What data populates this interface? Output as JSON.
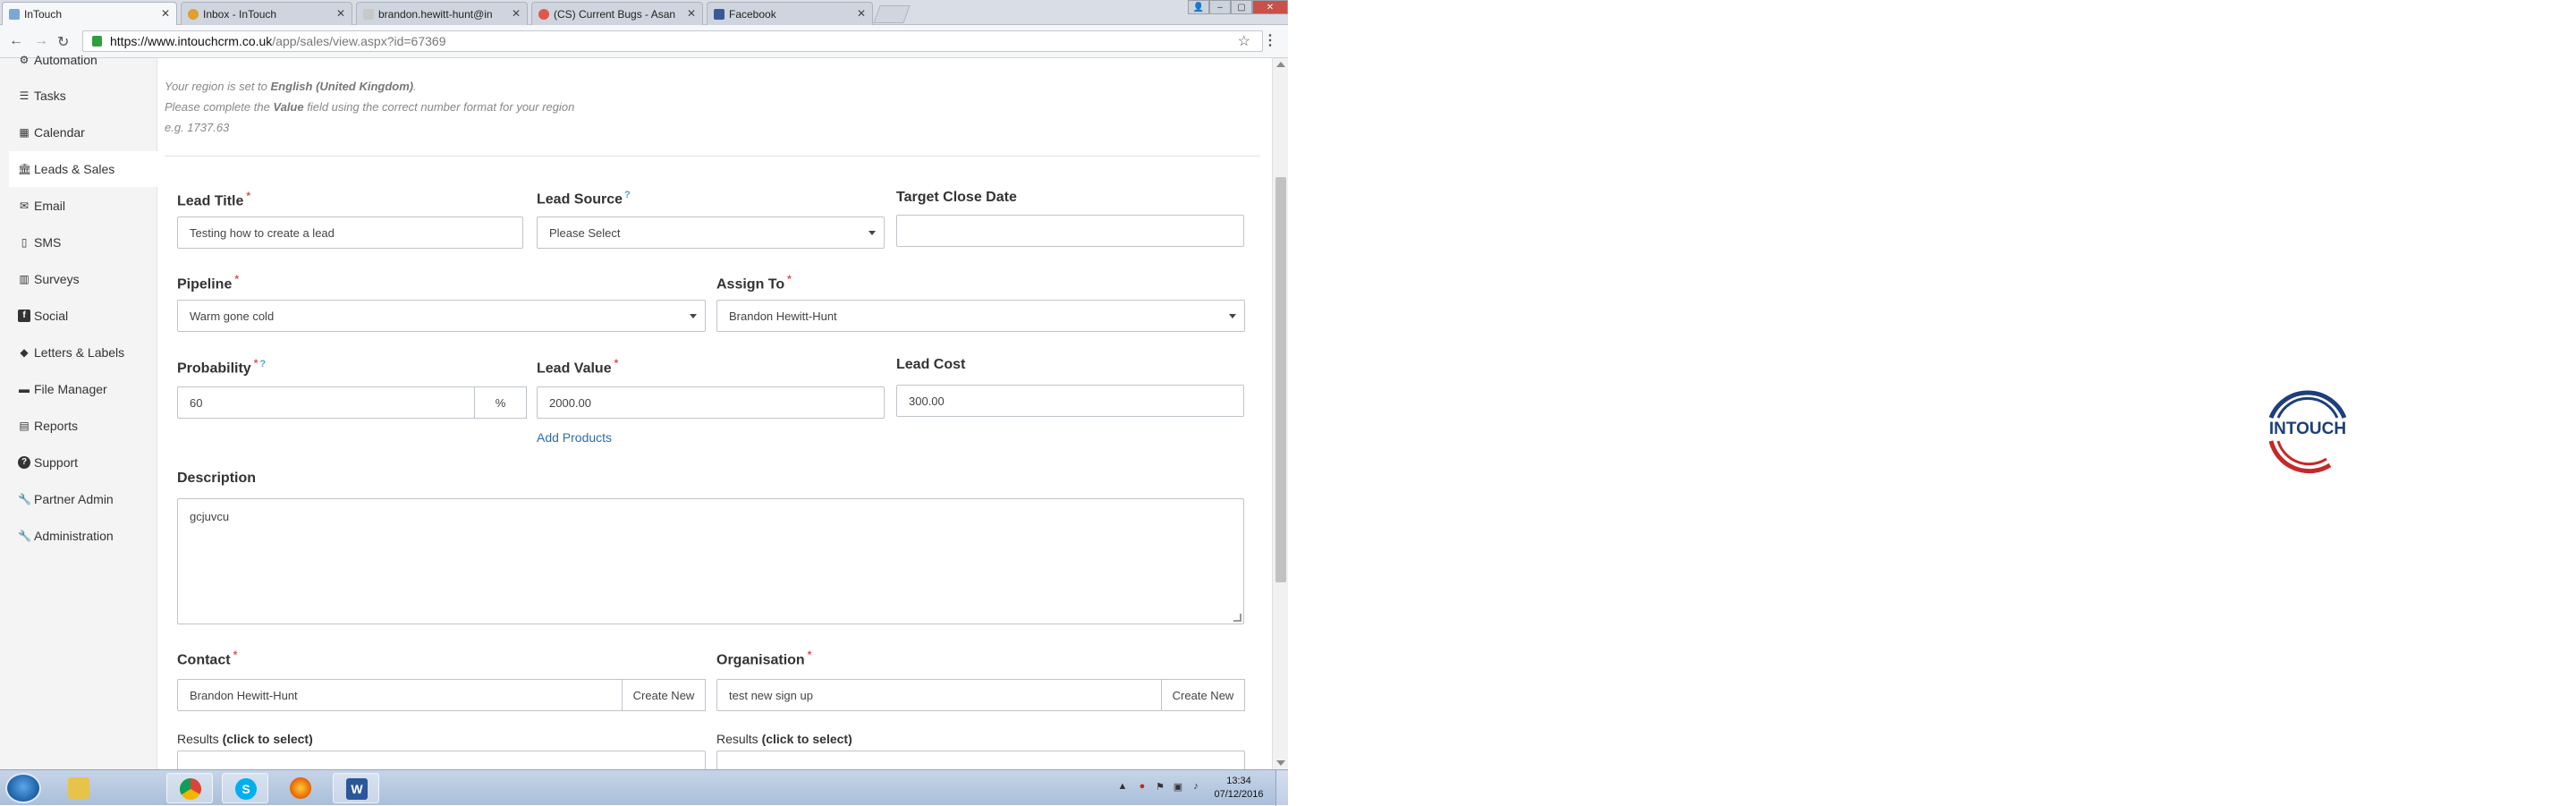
{
  "browser": {
    "tabs": [
      {
        "title": "InTouch",
        "fav": "#7aa7d9"
      },
      {
        "title": "Inbox - InTouch",
        "fav": "#e0a030"
      },
      {
        "title": "brandon.hewitt-hunt@in",
        "fav": "#c8c8c8"
      },
      {
        "title": "(CS) Current Bugs - Asan",
        "fav": "#e0584c"
      },
      {
        "title": "Facebook",
        "fav": "#3b5998"
      }
    ],
    "url_host": "https://www.intouchcrm.co.uk",
    "url_path": "/app/sales/view.aspx?id=67369"
  },
  "sidebar": {
    "items": [
      {
        "label": "Automation",
        "icon": "automation-icon"
      },
      {
        "label": "Tasks",
        "icon": "tasks-icon"
      },
      {
        "label": "Calendar",
        "icon": "calendar-icon"
      },
      {
        "label": "Leads & Sales",
        "icon": "bank-icon"
      },
      {
        "label": "Email",
        "icon": "envelope-icon"
      },
      {
        "label": "SMS",
        "icon": "mobile-icon"
      },
      {
        "label": "Surveys",
        "icon": "bar-chart-icon"
      },
      {
        "label": "Social",
        "icon": "facebook-icon"
      },
      {
        "label": "Letters & Labels",
        "icon": "tag-icon"
      },
      {
        "label": "File Manager",
        "icon": "folder-icon"
      },
      {
        "label": "Reports",
        "icon": "file-icon"
      },
      {
        "label": "Support",
        "icon": "question-icon"
      },
      {
        "label": "Partner Admin",
        "icon": "wrench-icon"
      },
      {
        "label": "Administration",
        "icon": "wrench-icon"
      }
    ]
  },
  "notes": {
    "region_prefix": "Your region is set to ",
    "region_value": "English (United Kingdom)",
    "region_suffix": ".",
    "value_prefix": "Please complete the ",
    "value_field": "Value",
    "value_suffix": " field using the correct number format for your region",
    "example": "e.g. 1737.63"
  },
  "form": {
    "lead_title_label": "Lead Title",
    "lead_title_value": "Testing how to create a lead",
    "lead_source_label": "Lead Source",
    "lead_source_value": "Please Select",
    "target_close_label": "Target Close Date",
    "target_close_value": "",
    "pipeline_label": "Pipeline",
    "pipeline_value": "Warm gone cold",
    "assign_to_label": "Assign To",
    "assign_to_value": "Brandon Hewitt-Hunt",
    "probability_label": "Probability",
    "probability_value": "60",
    "probability_unit": "%",
    "lead_value_label": "Lead Value",
    "lead_value_value": "2000.00",
    "lead_cost_label": "Lead Cost",
    "lead_cost_value": "300.00",
    "add_products": "Add Products",
    "description_label": "Description",
    "description_value": "gcjuvcu",
    "contact_label": "Contact",
    "contact_value": "Brandon Hewitt-Hunt",
    "contact_create": "Create New",
    "organisation_label": "Organisation",
    "organisation_value": "test new sign up",
    "organisation_create": "Create New",
    "results_label": "Results",
    "results_hint": "(click to select)",
    "required_mark": "*",
    "help_mark": "?"
  },
  "taskbar": {
    "time": "13:34",
    "date": "07/12/2016"
  },
  "logo": {
    "text": "INTOUCH",
    "color_blue": "#1d3f7a",
    "color_red": "#c62828"
  }
}
